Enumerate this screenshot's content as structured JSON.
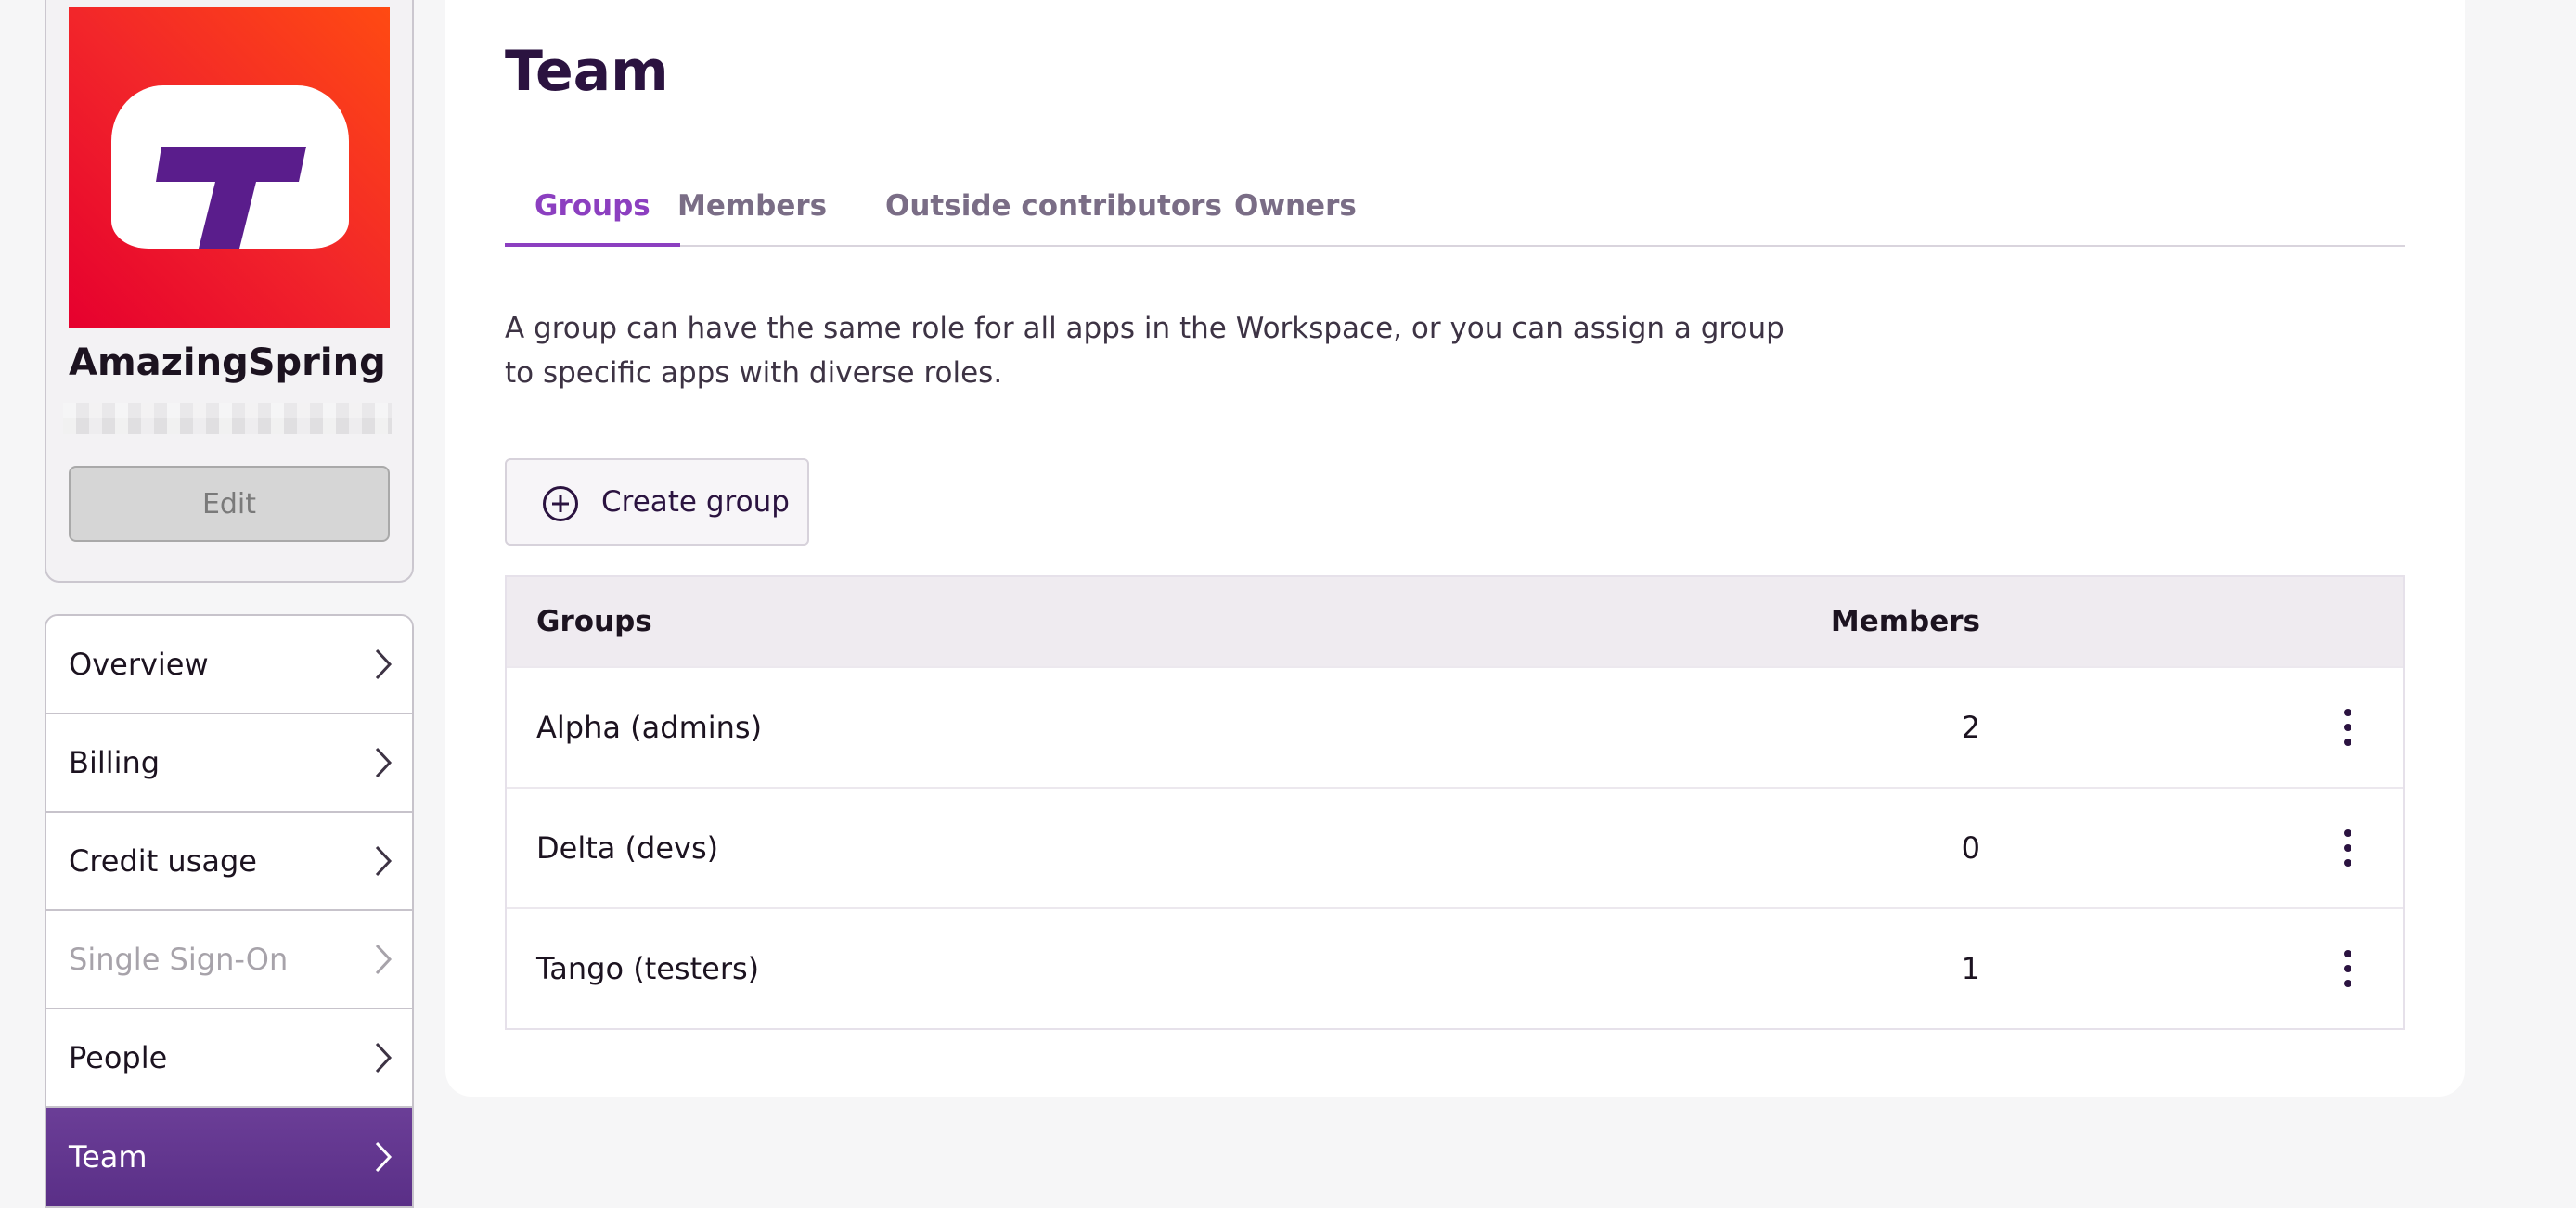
{
  "profile": {
    "org_name": "AmazingSpring",
    "edit_label": "Edit"
  },
  "nav": {
    "items": [
      {
        "label": "Overview"
      },
      {
        "label": "Billing"
      },
      {
        "label": "Credit usage"
      },
      {
        "label": "Single Sign-On",
        "disabled": true
      },
      {
        "label": "People"
      },
      {
        "label": "Team",
        "active": true
      }
    ]
  },
  "page": {
    "title": "Team",
    "tabs": [
      {
        "label": "Groups",
        "active": true
      },
      {
        "label": "Members"
      },
      {
        "label": "Outside contributors"
      },
      {
        "label": "Owners"
      }
    ],
    "description": "A group can have the same role for all apps in the Workspace, or you can assign a group to specific apps with diverse roles.",
    "create_button": "Create group"
  },
  "table": {
    "headers": {
      "groups": "Groups",
      "members": "Members"
    },
    "rows": [
      {
        "name": "Alpha (admins)",
        "members": "2"
      },
      {
        "name": "Delta (devs)",
        "members": "0"
      },
      {
        "name": "Tango (testers)",
        "members": "1"
      }
    ]
  },
  "colors": {
    "accent": "#8c3fc0",
    "nav_active": "#5a2f87",
    "logo_gradient_start": "#e6002e",
    "logo_gradient_end": "#ff4a12",
    "logo_letter": "#5a1d8c"
  },
  "icons": {
    "chevron": "chevron-right-icon",
    "create": "plus-circle-icon",
    "row_menu": "kebab-menu-icon"
  }
}
